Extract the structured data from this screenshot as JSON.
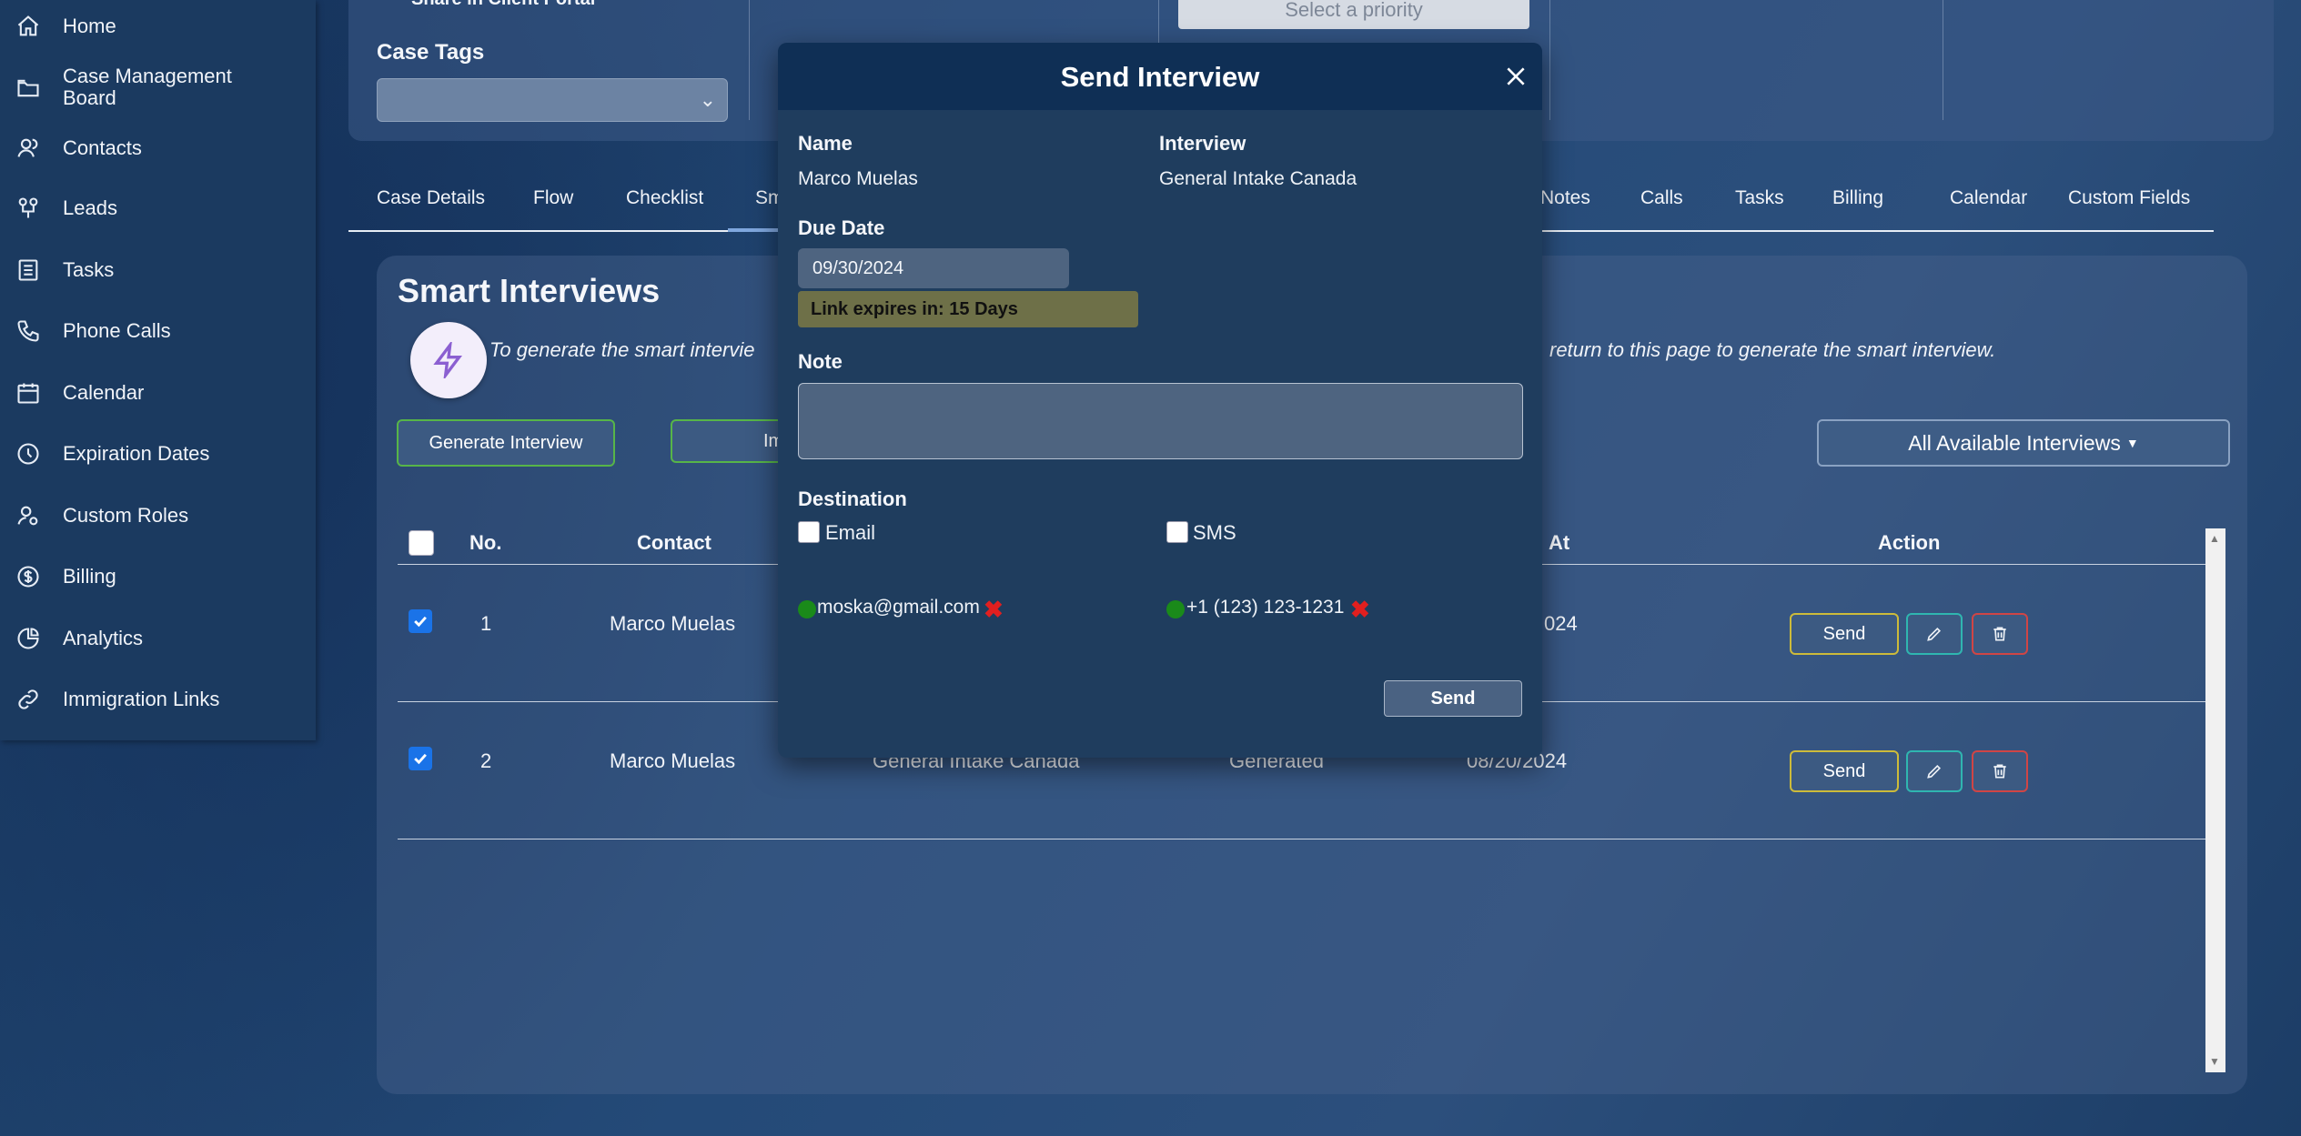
{
  "sidebar": {
    "items": [
      {
        "label": "Home",
        "icon": "home-icon"
      },
      {
        "label": "Case Management Board",
        "icon": "folder-icon"
      },
      {
        "label": "Contacts",
        "icon": "contacts-icon"
      },
      {
        "label": "Leads",
        "icon": "leads-icon"
      },
      {
        "label": "Tasks",
        "icon": "tasks-icon"
      },
      {
        "label": "Phone Calls",
        "icon": "phone-icon"
      },
      {
        "label": "Calendar",
        "icon": "calendar-icon"
      },
      {
        "label": "Expiration Dates",
        "icon": "clock-icon"
      },
      {
        "label": "Custom Roles",
        "icon": "user-gear-icon"
      },
      {
        "label": "Billing",
        "icon": "dollar-icon"
      },
      {
        "label": "Analytics",
        "icon": "pie-chart-icon"
      },
      {
        "label": "Immigration Links",
        "icon": "link-icon"
      }
    ]
  },
  "top_panel": {
    "share_label": "Share in Client Portal",
    "case_tags_label": "Case Tags",
    "priority_placeholder": "Select a priority"
  },
  "tabs": [
    {
      "label": "Case Details"
    },
    {
      "label": "Flow"
    },
    {
      "label": "Checklist"
    },
    {
      "label": "Sm"
    },
    {
      "label": "Notes"
    },
    {
      "label": "Calls"
    },
    {
      "label": "Tasks"
    },
    {
      "label": "Billing"
    },
    {
      "label": "Calendar"
    },
    {
      "label": "Custom Fields"
    }
  ],
  "smart_interviews": {
    "title": "Smart Interviews",
    "info_left": "To generate the smart intervie",
    "info_right": "return to this page to generate the smart interview.",
    "generate_button": "Generate Interview",
    "import_button": "Im",
    "filter_button": "All Available Interviews",
    "columns": {
      "no": "No.",
      "contact": "Contact",
      "at": "At",
      "action": "Action"
    },
    "rows": [
      {
        "no": "1",
        "contact": "Marco Muelas",
        "interview": "",
        "status": "",
        "date": "024",
        "checked": true
      },
      {
        "no": "2",
        "contact": "Marco Muelas",
        "interview": "General Intake Canada",
        "status": "Generated",
        "date": "08/20/2024",
        "checked": true
      }
    ],
    "send_label": "Send"
  },
  "modal": {
    "title": "Send Interview",
    "name_label": "Name",
    "name_value": "Marco Muelas",
    "interview_label": "Interview",
    "interview_value": "General Intake Canada",
    "due_label": "Due Date",
    "due_value": "09/30/2024",
    "expires_text": "Link expires in: 15 Days",
    "note_label": "Note",
    "note_value": "",
    "destination_label": "Destination",
    "email_label": "Email",
    "sms_label": "SMS",
    "email_value": "moska@gmail.com",
    "phone_value": "+1 (123) 123-1231",
    "send_button": "Send"
  },
  "colors": {
    "accent_green": "#57b548",
    "send_border": "#cdbb3a",
    "edit_border": "#2fb6b0",
    "delete_border": "#d04545",
    "checkbox_blue": "#1a73e8",
    "status_dot": "#1a8a1a",
    "remove_red": "#e21f1f"
  }
}
